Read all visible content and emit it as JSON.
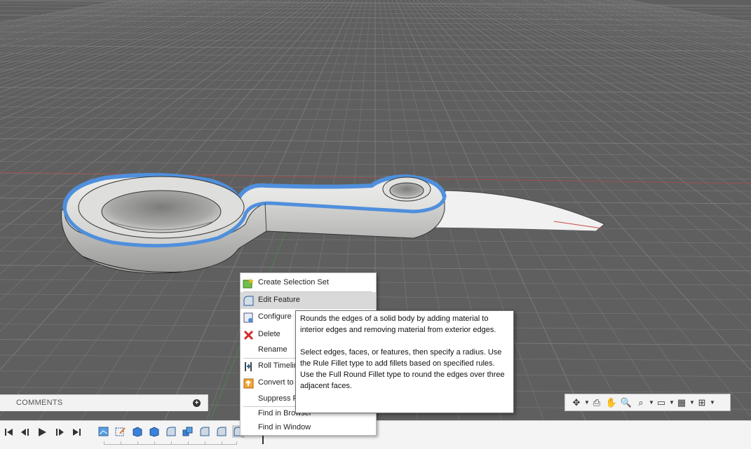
{
  "context_menu": {
    "items": [
      {
        "label": "Create Selection Set",
        "icon": "selection-set-icon"
      },
      {
        "label": "Edit Feature",
        "icon": "fillet-icon",
        "highlighted": true
      },
      {
        "label": "Configure",
        "icon": "configure-icon"
      },
      {
        "label": "Delete",
        "icon": "delete-icon"
      },
      {
        "label": "Rename",
        "icon": ""
      },
      {
        "label": "Roll Timeline",
        "icon": "roll-timeline-icon"
      },
      {
        "label": "Convert to",
        "icon": "convert-icon"
      },
      {
        "label": "Suppress F",
        "icon": ""
      },
      {
        "label": "Find in Browser",
        "icon": ""
      },
      {
        "label": "Find in Window",
        "icon": ""
      }
    ]
  },
  "tooltip": {
    "paragraph1": "Rounds the edges of a solid body by adding material to interior edges and removing material from exterior edges.",
    "paragraph2": "Select edges, faces, or features, then specify a radius. Use the Rule Fillet type to add fillets based on specified rules. Use the Full Round Fillet type to round the edges over three adjacent faces."
  },
  "comments": {
    "label": "COMMENTS"
  },
  "playback": [
    "first-frame-icon",
    "step-back-icon",
    "play-icon",
    "step-forward-icon",
    "last-frame-icon"
  ],
  "timeline_features": [
    "sketch-icon",
    "sketch-icon",
    "extrude-icon",
    "extrude-icon",
    "fillet-icon",
    "extrude-icon",
    "fillet-icon",
    "fillet-icon",
    "fillet-icon"
  ],
  "navbar": [
    "orbit-icon",
    "look-at-icon",
    "pan-icon",
    "zoom-icon",
    "fit-icon",
    "display-settings-icon",
    "grid-icon",
    "viewports-icon"
  ],
  "colors": {
    "accent_blue": "#4f8fdc",
    "grid_background": "#5f5f5f",
    "delete_red": "#d62828"
  }
}
